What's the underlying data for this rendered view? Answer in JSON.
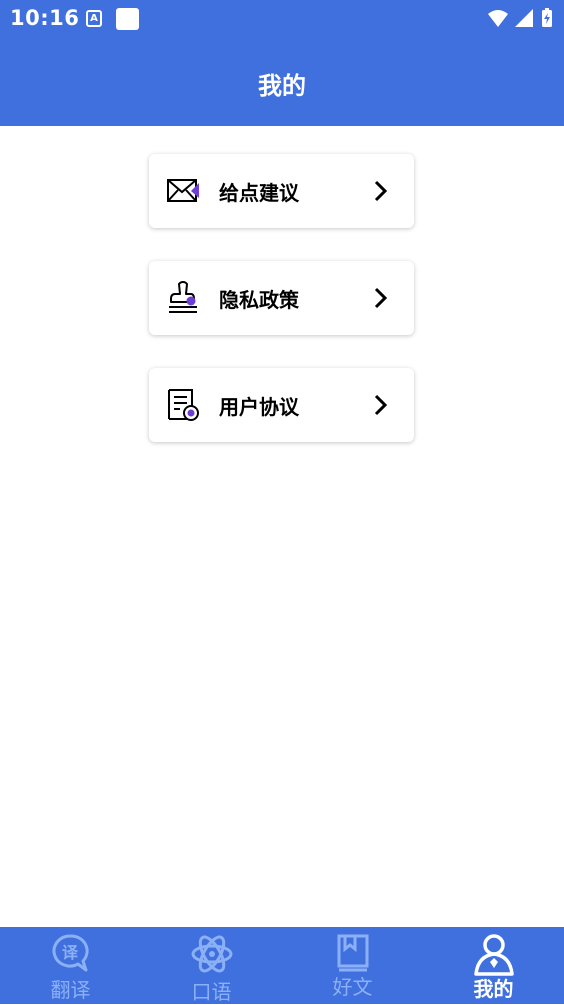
{
  "status": {
    "time": "10:16",
    "a_glyph": "A"
  },
  "header": {
    "title": "我的"
  },
  "menu": {
    "items": [
      {
        "label": "给点建议",
        "icon": "envelope-icon"
      },
      {
        "label": "隐私政策",
        "icon": "stamp-icon"
      },
      {
        "label": "用户协议",
        "icon": "document-seal-icon"
      }
    ]
  },
  "tabs": [
    {
      "label": "翻译",
      "icon": "translate-bubble-icon",
      "icon_glyph": "译",
      "active": false
    },
    {
      "label": "口语",
      "icon": "atom-icon",
      "active": false
    },
    {
      "label": "好文",
      "icon": "book-icon",
      "active": false
    },
    {
      "label": "我的",
      "icon": "user-icon",
      "active": true
    }
  ],
  "colors": {
    "primary": "#4070DE",
    "inactive_tab": "#8CB0F5",
    "accent_purple": "#6B3FD6"
  }
}
